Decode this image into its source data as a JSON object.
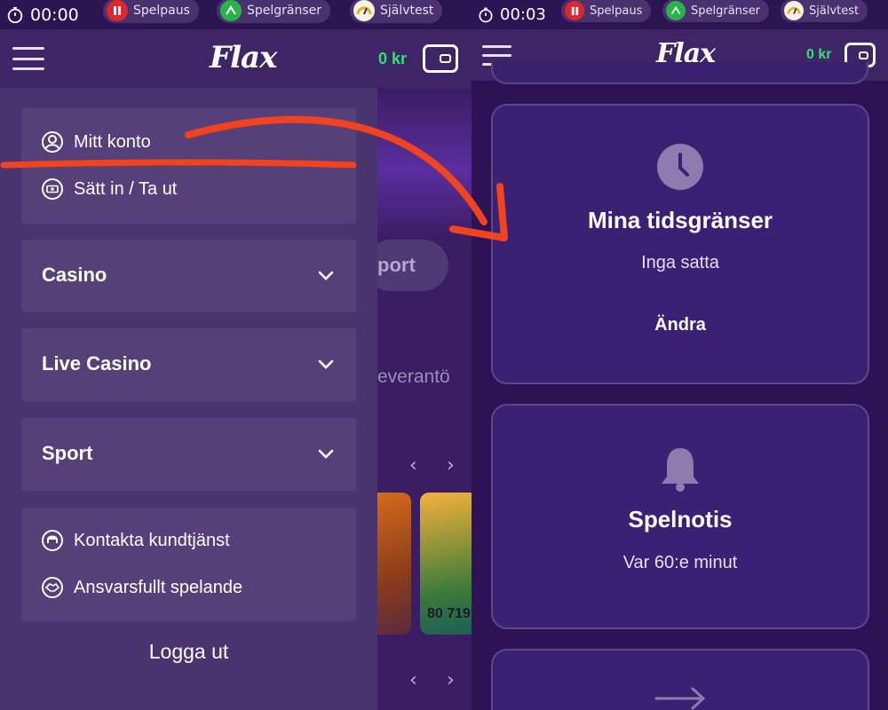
{
  "left": {
    "timer": "00:00",
    "pills": [
      {
        "label": "Spelpaus",
        "icon": "pause-icon"
      },
      {
        "label": "Spelgränser",
        "icon": "limits-icon"
      },
      {
        "label": "Självtest",
        "icon": "gauge-icon"
      }
    ],
    "logo": "Flax",
    "balance": "0 kr",
    "background": {
      "sport_pill": "port",
      "providers_text": "everantö",
      "card_value": "80 719"
    },
    "drawer": {
      "account_items": [
        {
          "label": "Mitt konto",
          "icon": "user-circle-icon"
        },
        {
          "label": "Sätt in / Ta ut",
          "icon": "money-icon"
        }
      ],
      "categories": [
        {
          "label": "Casino"
        },
        {
          "label": "Live Casino"
        },
        {
          "label": "Sport"
        }
      ],
      "support_items": [
        {
          "label": "Kontakta kundtjänst",
          "icon": "support-icon"
        },
        {
          "label": "Ansvarsfullt spelande",
          "icon": "handshake-icon"
        }
      ],
      "logout": "Logga ut"
    }
  },
  "right": {
    "timer": "00:03",
    "pills": [
      {
        "label": "Spelpaus",
        "icon": "pause-icon"
      },
      {
        "label": "Spelgränser",
        "icon": "limits-icon"
      },
      {
        "label": "Självtest",
        "icon": "gauge-icon"
      }
    ],
    "logo": "Flax",
    "balance": "0 kr",
    "cards": [
      {
        "title": "Mina tidsgränser",
        "subtitle": "Inga satta",
        "action": "Ändra",
        "icon": "clock-icon"
      },
      {
        "title": "Spelnotis",
        "subtitle": "Var 60:e minut",
        "icon": "bell-icon"
      },
      {
        "icon": "arrow-right-icon"
      }
    ]
  },
  "colors": {
    "accent_green": "#30e27a",
    "annotation_red": "#f1441e",
    "pause_red": "#e0262f",
    "limits_green": "#2ab34a"
  }
}
